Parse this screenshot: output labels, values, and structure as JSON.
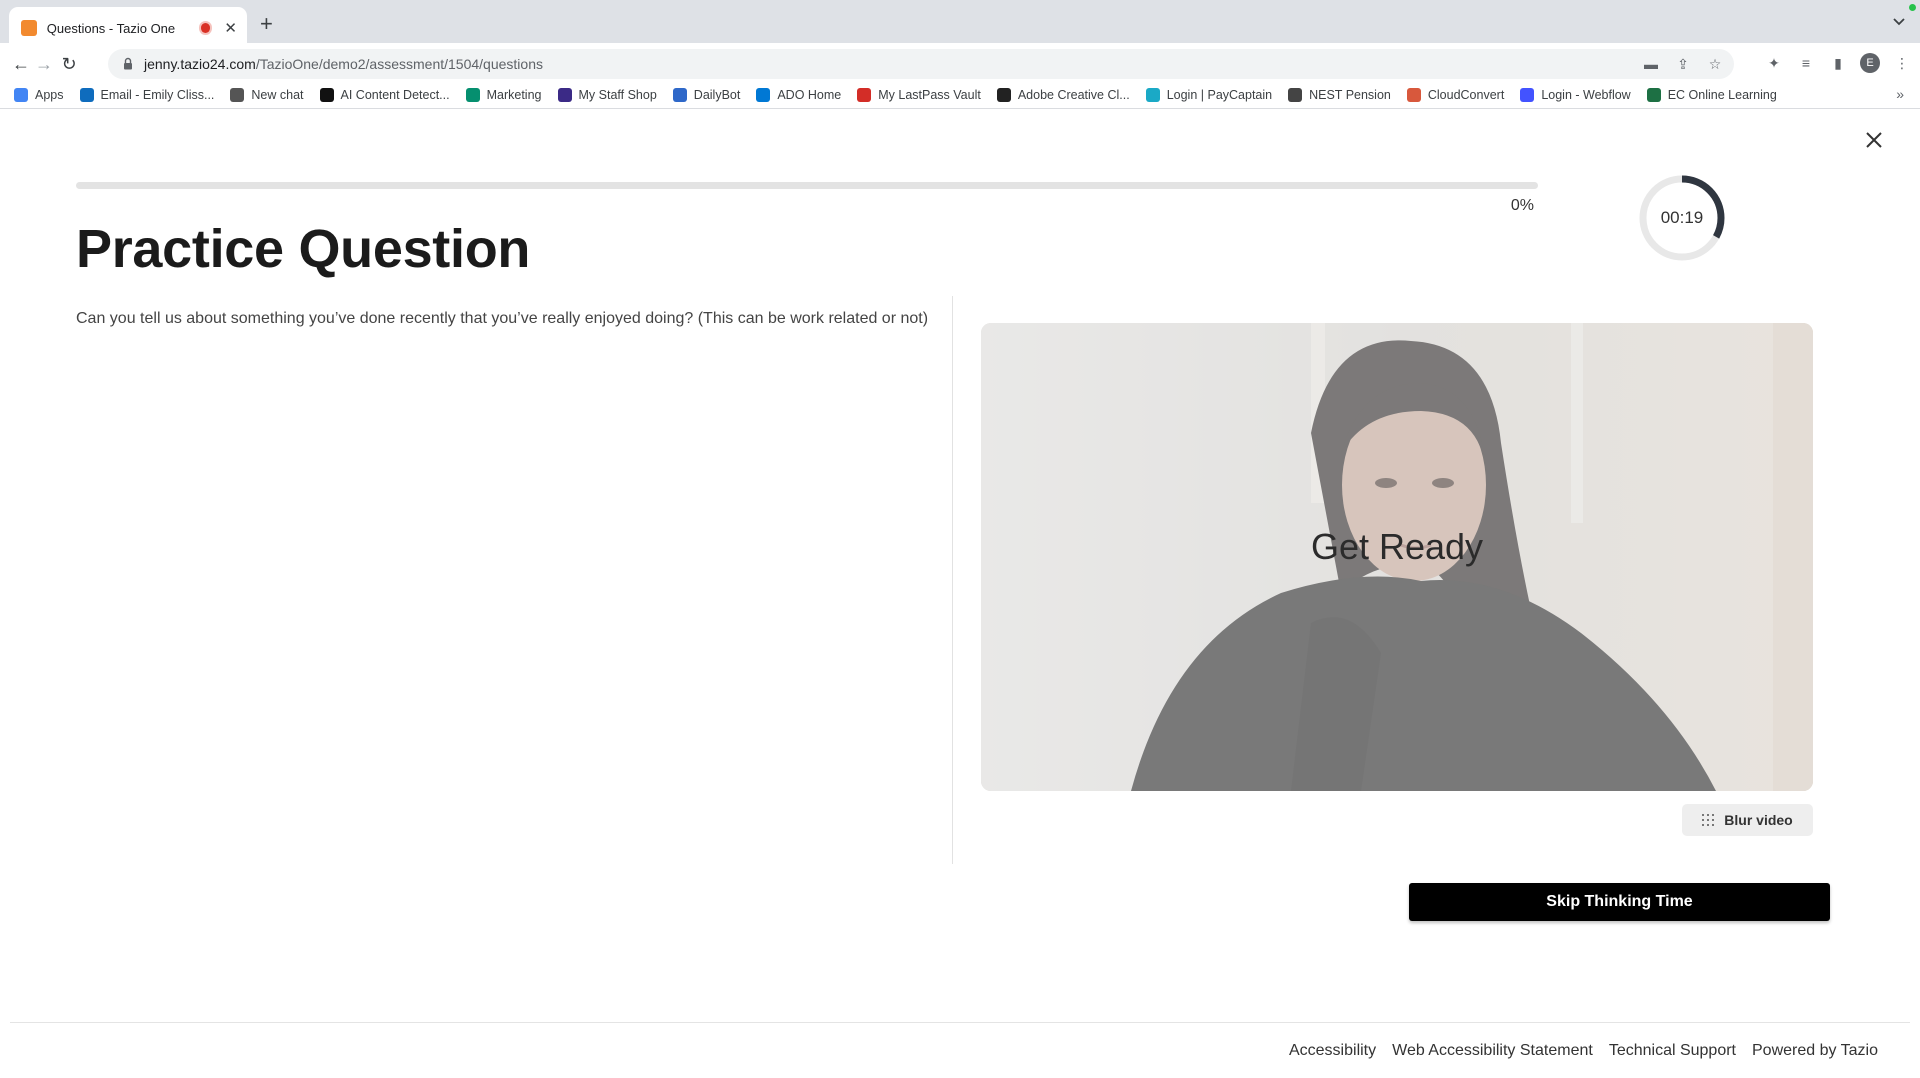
{
  "browser": {
    "tab_title": "Questions - Tazio One",
    "url_host": "jenny.tazio24.com",
    "url_path": "/TazioOne/demo2/assessment/1504/questions",
    "profile_initial": "E"
  },
  "bookmarks": [
    {
      "label": "Apps",
      "icon": "apps-grid-icon",
      "color": "#4285f4"
    },
    {
      "label": "Email - Emily Cliss...",
      "icon": "outlook-icon",
      "color": "#0f6cbd"
    },
    {
      "label": "New chat",
      "icon": "openai-icon",
      "color": "#555555"
    },
    {
      "label": "AI Content Detect...",
      "icon": "writer-w-icon",
      "color": "#111111"
    },
    {
      "label": "Marketing",
      "icon": "sharepoint-icon",
      "color": "#058f6f"
    },
    {
      "label": "My Staff Shop",
      "icon": "mystaffshop-icon",
      "color": "#3b2a86"
    },
    {
      "label": "DailyBot",
      "icon": "dailybot-icon",
      "color": "#2e68c9"
    },
    {
      "label": "ADO Home",
      "icon": "azure-devops-icon",
      "color": "#0078d4"
    },
    {
      "label": "My LastPass Vault",
      "icon": "lastpass-icon",
      "color": "#d32d27"
    },
    {
      "label": "Adobe Creative Cl...",
      "icon": "adobe-icon",
      "color": "#222222"
    },
    {
      "label": "Login | PayCaptain",
      "icon": "paycaptain-icon",
      "color": "#1aa9c6"
    },
    {
      "label": "NEST Pension",
      "icon": "nest-icon",
      "color": "#444444"
    },
    {
      "label": "CloudConvert",
      "icon": "cloudconvert-icon",
      "color": "#d8583c"
    },
    {
      "label": "Login - Webflow",
      "icon": "webflow-icon",
      "color": "#4353ff"
    },
    {
      "label": "EC Online Learning",
      "icon": "excel-icon",
      "color": "#1d7044"
    }
  ],
  "assessment": {
    "progress_label": "0%",
    "progress_value": 0,
    "timer_label": "00:19",
    "timer_fraction_remaining": 0.33,
    "heading": "Practice Question",
    "question": "Can you tell us about something you’ve done recently that you’ve really enjoyed doing? (This can be work related or not)",
    "video_status": "Get Ready",
    "blur_label": "Blur video",
    "skip_label": "Skip Thinking Time"
  },
  "footer": {
    "accessibility": "Accessibility",
    "statement": "Web Accessibility Statement",
    "support": "Technical Support",
    "powered": "Powered by Tazio"
  },
  "colors": {
    "accent": "#000000",
    "timer_ring": "#2f3640",
    "tab_favicon": "#f28a2f",
    "recording": "#d93025"
  }
}
